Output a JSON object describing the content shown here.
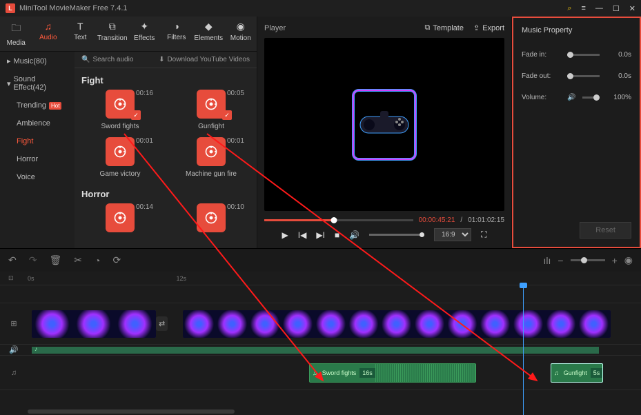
{
  "app": {
    "title": "MiniTool MovieMaker Free 7.4.1"
  },
  "tabs": {
    "media": "Media",
    "audio": "Audio",
    "text": "Text",
    "transition": "Transition",
    "effects": "Effects",
    "filters": "Filters",
    "elements": "Elements",
    "motion": "Motion"
  },
  "sidebar": {
    "music": "Music(80)",
    "sound_effect": "Sound Effect(42)",
    "items": [
      "Trending",
      "Ambience",
      "Fight",
      "Horror",
      "Voice"
    ],
    "hot": "Hot"
  },
  "audio_header": {
    "search": "Search audio",
    "download": "Download YouTube Videos"
  },
  "sections": {
    "fight": {
      "title": "Fight",
      "items": [
        {
          "name": "Sword fights",
          "dur": "00:16",
          "checked": true
        },
        {
          "name": "Gunfight",
          "dur": "00:05",
          "checked": true
        },
        {
          "name": "Game victory",
          "dur": "00:01",
          "checked": false
        },
        {
          "name": "Machine gun fire",
          "dur": "00:01",
          "checked": false
        }
      ]
    },
    "horror": {
      "title": "Horror",
      "items": [
        {
          "name": "",
          "dur": "00:14"
        },
        {
          "name": "",
          "dur": "00:10"
        }
      ]
    }
  },
  "player": {
    "label": "Player",
    "template": "Template",
    "export": "Export",
    "cur": "00:00:45:21",
    "total": "01:01:02:15",
    "ratio": "16:9"
  },
  "props": {
    "title": "Music Property",
    "fade_in": {
      "label": "Fade in:",
      "val": "0.0s"
    },
    "fade_out": {
      "label": "Fade out:",
      "val": "0.0s"
    },
    "volume": {
      "label": "Volume:",
      "val": "100%"
    },
    "reset": "Reset"
  },
  "ruler": {
    "t0": "0s",
    "t1": "12s"
  },
  "clips": {
    "sword": {
      "name": "Sword fights",
      "dur": "16s"
    },
    "gun": {
      "name": "Gunfight",
      "dur": "5s"
    }
  }
}
